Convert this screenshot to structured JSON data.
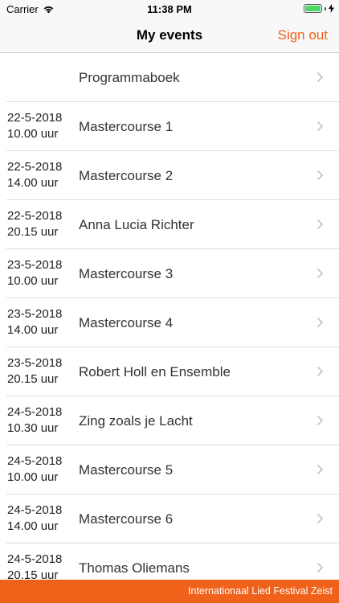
{
  "status_bar": {
    "carrier": "Carrier",
    "time": "11:38 PM",
    "battery_level": 1.0
  },
  "nav": {
    "title": "My events",
    "sign_out_label": "Sign out"
  },
  "colors": {
    "accent": "#f0611a"
  },
  "events": [
    {
      "date": "",
      "time": "",
      "title": "Programmaboek"
    },
    {
      "date": "22-5-2018",
      "time": "10.00 uur",
      "title": "Mastercourse 1"
    },
    {
      "date": "22-5-2018",
      "time": "14.00 uur",
      "title": "Mastercourse 2"
    },
    {
      "date": "22-5-2018",
      "time": "20.15 uur",
      "title": "Anna Lucia Richter"
    },
    {
      "date": "23-5-2018",
      "time": "10.00 uur",
      "title": "Mastercourse 3"
    },
    {
      "date": "23-5-2018",
      "time": "14.00 uur",
      "title": "Mastercourse 4"
    },
    {
      "date": "23-5-2018",
      "time": "20.15 uur",
      "title": "Robert Holl en Ensemble"
    },
    {
      "date": "24-5-2018",
      "time": "10.30 uur",
      "title": "Zing zoals je Lacht"
    },
    {
      "date": "24-5-2018",
      "time": "10.00 uur",
      "title": "Mastercourse 5"
    },
    {
      "date": "24-5-2018",
      "time": "14.00 uur",
      "title": "Mastercourse 6"
    },
    {
      "date": "24-5-2018",
      "time": "20.15 uur",
      "title": "Thomas Oliemans"
    }
  ],
  "footer": {
    "text": "Internationaal Lied Festival Zeist"
  }
}
